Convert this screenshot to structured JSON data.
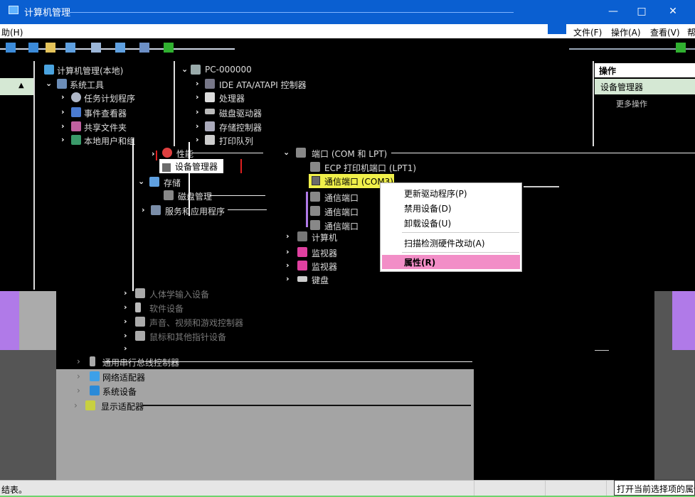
{
  "window": {
    "title": "计算机管理",
    "controls": {
      "minimize": "—",
      "maximize": "□",
      "close": "✕"
    }
  },
  "menubar": {
    "left_fragment": "助(H)",
    "items": [
      "文件(F)",
      "操作(A)",
      "查看(V)",
      "帮"
    ]
  },
  "left_tree": [
    {
      "label": "计算机管理(本地)",
      "icon": "computer-management-icon"
    },
    {
      "label": "系统工具",
      "icon": "tools-icon"
    },
    {
      "label": "任务计划程序",
      "icon": "clock-icon"
    },
    {
      "label": "事件查看器",
      "icon": "event-icon"
    },
    {
      "label": "共享文件夹",
      "icon": "share-icon"
    },
    {
      "label": "本地用户和组",
      "icon": "users-icon"
    }
  ],
  "mid_tree_top": [
    {
      "label": "PC-000000",
      "icon": "computer-icon"
    },
    {
      "label": "IDE ATA/ATAPI 控制器",
      "icon": "ide-icon"
    },
    {
      "label": "处理器",
      "icon": "cpu-icon"
    },
    {
      "label": "磁盘驱动器",
      "icon": "disk-icon"
    },
    {
      "label": "存储控制器",
      "icon": "storage-icon"
    },
    {
      "label": "打印队列",
      "icon": "printer-icon"
    }
  ],
  "overlay_tree": {
    "performance": "性能",
    "device_manager": "设备管理器",
    "storage": "存储",
    "disk_management": "磁盘管理",
    "services": "服务和应用程序"
  },
  "ports_tree": {
    "ports_group": "端口 (COM 和 LPT)",
    "lpt1": "ECP 打印机端口 (LPT1)",
    "com3": "通信端口 (COM3)",
    "other_ports": [
      "通信端口",
      "通信端口",
      "通信端口"
    ],
    "after": [
      "计算机",
      "监视器",
      "键盘"
    ]
  },
  "actions_pane": {
    "header": "操作",
    "section": "设备管理器",
    "more": "更多操作"
  },
  "context_menu": {
    "items": [
      "更新驱动程序(P)",
      "禁用设备(D)",
      "卸载设备(U)",
      "扫描检测硬件改动(A)",
      "属性(R)"
    ],
    "highlighted": "属性(R)"
  },
  "lower_tree_dark": [
    {
      "label": "人体学输入设备",
      "icon": "hid-icon"
    },
    {
      "label": "软件设备",
      "icon": "software-icon"
    },
    {
      "label": "声音、视频和游戏控制器",
      "icon": "sound-icon"
    },
    {
      "label": "鼠标和其他指针设备",
      "icon": "mouse-icon"
    }
  ],
  "lower_tree_light": [
    {
      "label": "通用串行总线控制器",
      "icon": "usb-icon"
    },
    {
      "label": "网络适配器",
      "icon": "network-icon"
    },
    {
      "label": "系统设备",
      "icon": "folder-icon"
    },
    {
      "label": "显示适配器",
      "icon": "display-icon"
    }
  ],
  "status": {
    "left": "结表。",
    "tip": "打开当前选择项的属性"
  },
  "colors": {
    "titlebar": "#0a5fd1",
    "highlight_yellow": "#f0f04a",
    "menu_highlight": "#f28ec7",
    "action_green": "#d5e8d4",
    "purple_block": "#b07ae8"
  }
}
